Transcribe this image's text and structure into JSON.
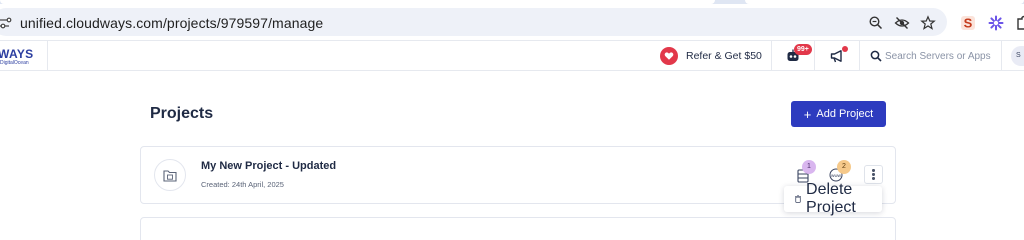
{
  "browser": {
    "url": "unified.cloudways.com/projects/979597/manage"
  },
  "header": {
    "logo_text": "WAYS",
    "logo_subtext": "DigitalOcean",
    "refer_label": "Refer & Get $50",
    "notification_count": "99+",
    "search_placeholder": "Search Servers or Apps",
    "avatar_initial": "S"
  },
  "main": {
    "page_title": "Projects",
    "add_project_label": "Add Project",
    "projects": [
      {
        "name": "My New Project - Updated",
        "created": "Created: 24th April, 2025",
        "server_count": "1",
        "website_count": "2"
      }
    ],
    "menu": {
      "delete_label": "Delete Project"
    }
  },
  "colors": {
    "accent": "#2d3bbf",
    "danger": "#e2384a",
    "server_badge": "#d9b6ef",
    "website_badge": "#f6c98a"
  }
}
